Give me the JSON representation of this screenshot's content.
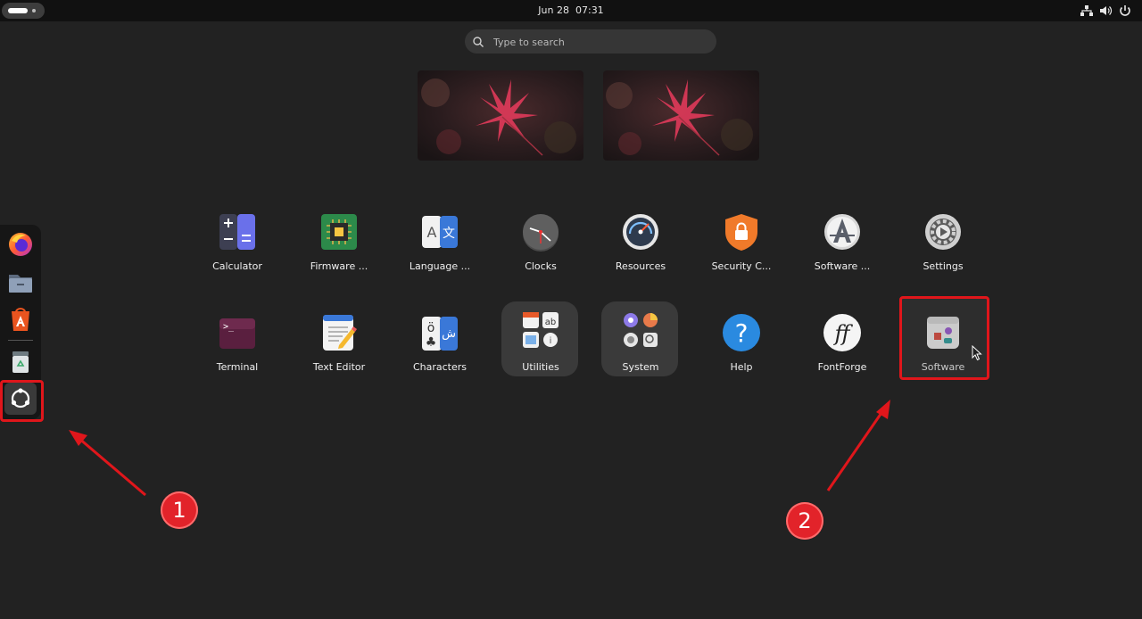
{
  "topbar": {
    "date": "Jun 28",
    "time": "07:31"
  },
  "search": {
    "placeholder": "Type to search"
  },
  "apps_row1": [
    {
      "label": "Calculator",
      "icon": "calculator-icon"
    },
    {
      "label": "Firmware ...",
      "icon": "firmware-icon"
    },
    {
      "label": "Language ...",
      "icon": "language-icon"
    },
    {
      "label": "Clocks",
      "icon": "clocks-icon"
    },
    {
      "label": "Resources",
      "icon": "resources-icon"
    },
    {
      "label": "Security C...",
      "icon": "security-center-icon"
    },
    {
      "label": "Software ...",
      "icon": "software-updater-icon"
    },
    {
      "label": "Settings",
      "icon": "settings-icon"
    }
  ],
  "apps_row2": [
    {
      "label": "Terminal",
      "icon": "terminal-icon"
    },
    {
      "label": "Text Editor",
      "icon": "text-editor-icon"
    },
    {
      "label": "Characters",
      "icon": "characters-icon"
    },
    {
      "label": "Utilities",
      "icon": "utilities-folder-icon"
    },
    {
      "label": "System",
      "icon": "system-folder-icon"
    },
    {
      "label": "Help",
      "icon": "help-icon"
    },
    {
      "label": "FontForge",
      "icon": "fontforge-icon"
    },
    {
      "label": "Software",
      "icon": "software-icon"
    }
  ],
  "dock": [
    "firefox-icon",
    "files-icon",
    "app-center-icon",
    "trash-icon",
    "show-apps-icon"
  ],
  "annotations": {
    "badge1": "1",
    "badge2": "2",
    "color": "#e0161b"
  },
  "colors": {
    "background": "#222222",
    "topbar": "#111111",
    "search_bg": "#363636"
  }
}
